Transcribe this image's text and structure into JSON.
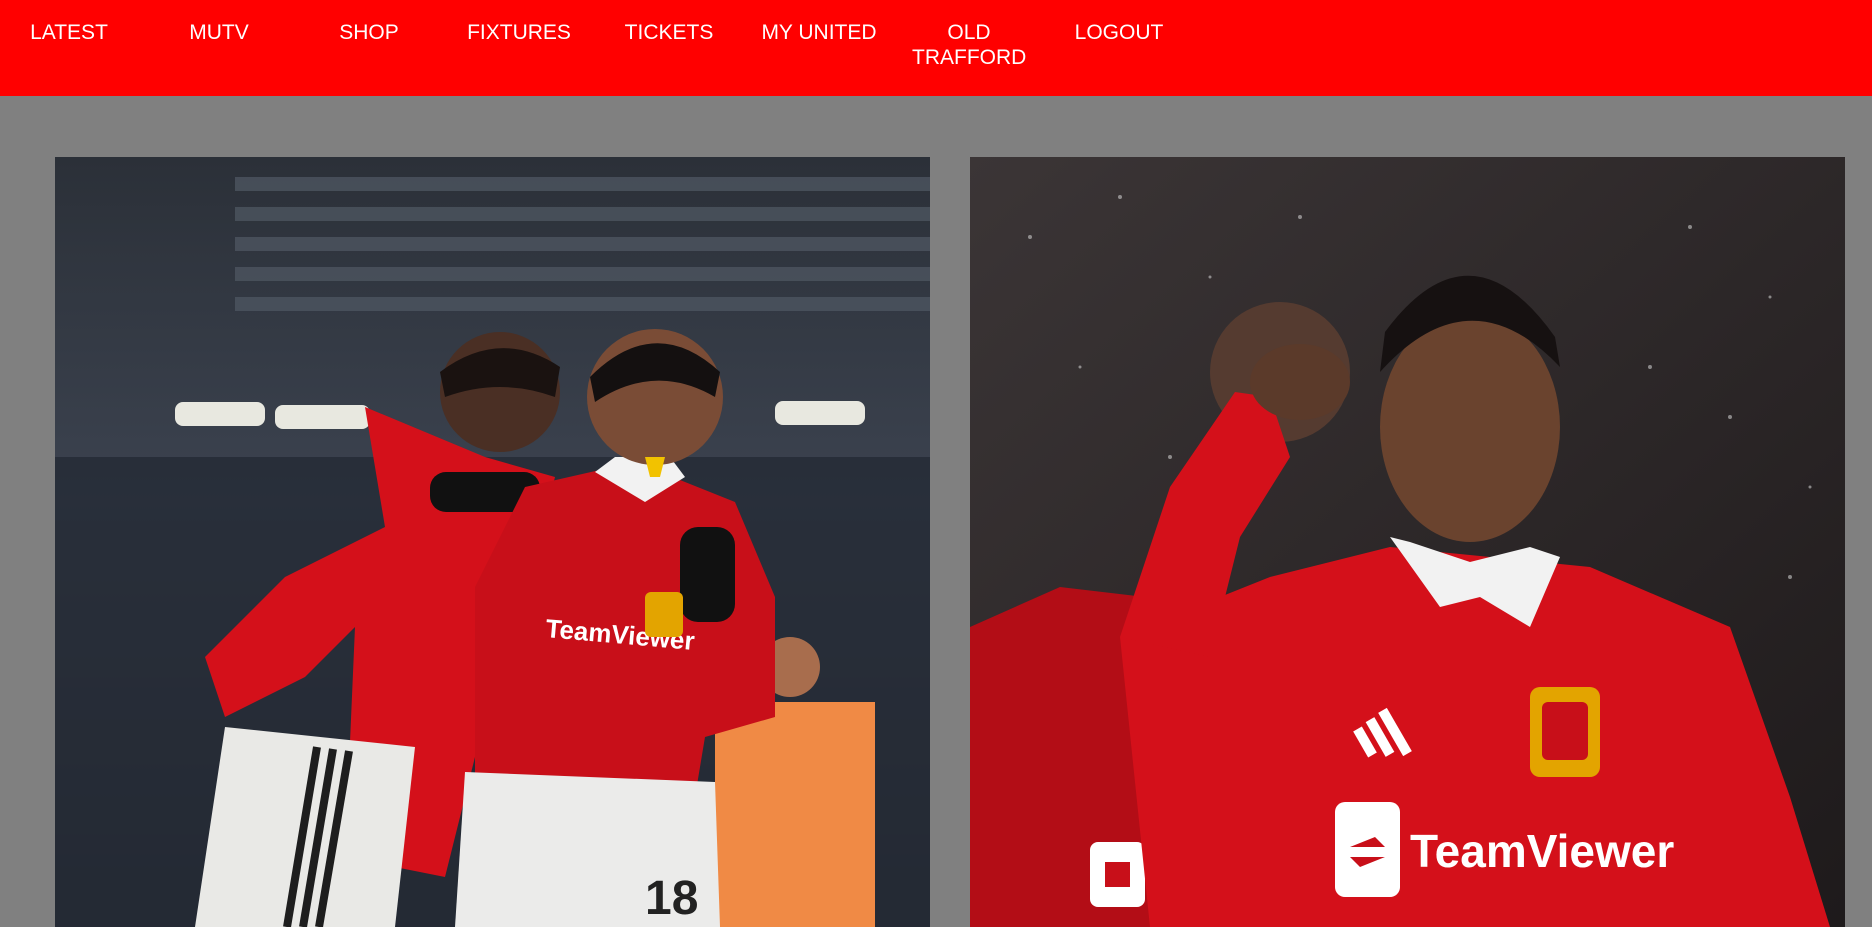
{
  "nav": {
    "items": [
      {
        "label": "LATEST"
      },
      {
        "label": "MUTV"
      },
      {
        "label": "SHOP"
      },
      {
        "label": "FIXTURES"
      },
      {
        "label": "TICKETS"
      },
      {
        "label": "MY UNITED"
      },
      {
        "label": "OLD TRAFFORD"
      },
      {
        "label": "LOGOUT"
      }
    ]
  },
  "photos": [
    {
      "kind": "two-players-celebrating",
      "jersey_sponsor": "TeamViewer",
      "number": "18"
    },
    {
      "kind": "player-pointing-to-head",
      "jersey_sponsor": "TeamViewer"
    }
  ],
  "colors": {
    "nav_background": "#ff0000",
    "page_background": "#808080",
    "nav_text": "#ffffff",
    "kit_red": "#d4101a"
  }
}
